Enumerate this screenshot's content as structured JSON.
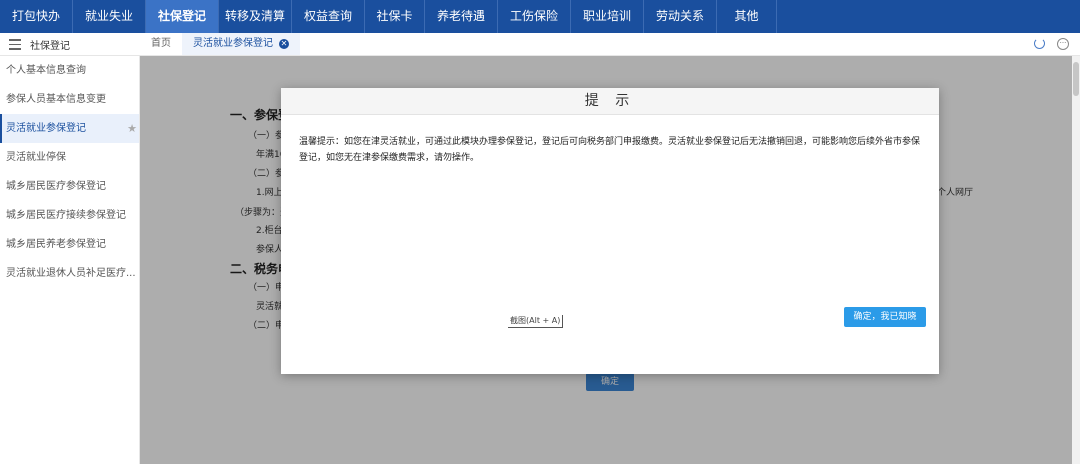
{
  "topnav": {
    "items": [
      {
        "label": "打包快办"
      },
      {
        "label": "就业失业"
      },
      {
        "label": "社保登记"
      },
      {
        "label": "转移及清算"
      },
      {
        "label": "权益查询"
      },
      {
        "label": "社保卡"
      },
      {
        "label": "养老待遇"
      },
      {
        "label": "工伤保险"
      },
      {
        "label": "职业培训"
      },
      {
        "label": "劳动关系"
      },
      {
        "label": "其他"
      }
    ],
    "active_index": 2,
    "background": "#1a4f9e"
  },
  "subbar": {
    "sidebar_title": "社保登记",
    "tabs": [
      {
        "label": "首页"
      },
      {
        "label": "灵活就业参保登记"
      }
    ]
  },
  "sidebar": {
    "items": [
      {
        "label": "个人基本信息查询"
      },
      {
        "label": "参保人员基本信息变更"
      },
      {
        "label": "灵活就业参保登记"
      },
      {
        "label": "灵活就业停保"
      },
      {
        "label": "城乡居民医疗参保登记"
      },
      {
        "label": "城乡居民医疗接续参保登记"
      },
      {
        "label": "城乡居民养老参保登记"
      },
      {
        "label": "灵活就业退休人员补足医疗..."
      }
    ],
    "active_index": 2
  },
  "main": {
    "heading1": "一、参保登",
    "line1": "（一）参",
    "line2": "年满16",
    "line3": "（二）参",
    "line4": "1.网上",
    "line5": "（步骤为：登",
    "line6": "2.柜台",
    "line7": "参保人",
    "heading2": "二、税务申",
    "line8": "（一）申",
    "line9": "灵活就",
    "line10": "（二）申",
    "right_fragment": "给个人网厅",
    "confirm_label": "确定"
  },
  "modal": {
    "title": "提 示",
    "body": "温馨提示：如您在津灵活就业，可通过此模块办理参保登记，登记后可向税务部门申报缴费。灵活就业参保登记后无法撤销回退，可能影响您后续外省市参保登记，如您无在津参保缴费需求，请勿操作。",
    "screenshot_hint": "截图(Alt + A)",
    "ok_label": "确定，我已知晓"
  }
}
